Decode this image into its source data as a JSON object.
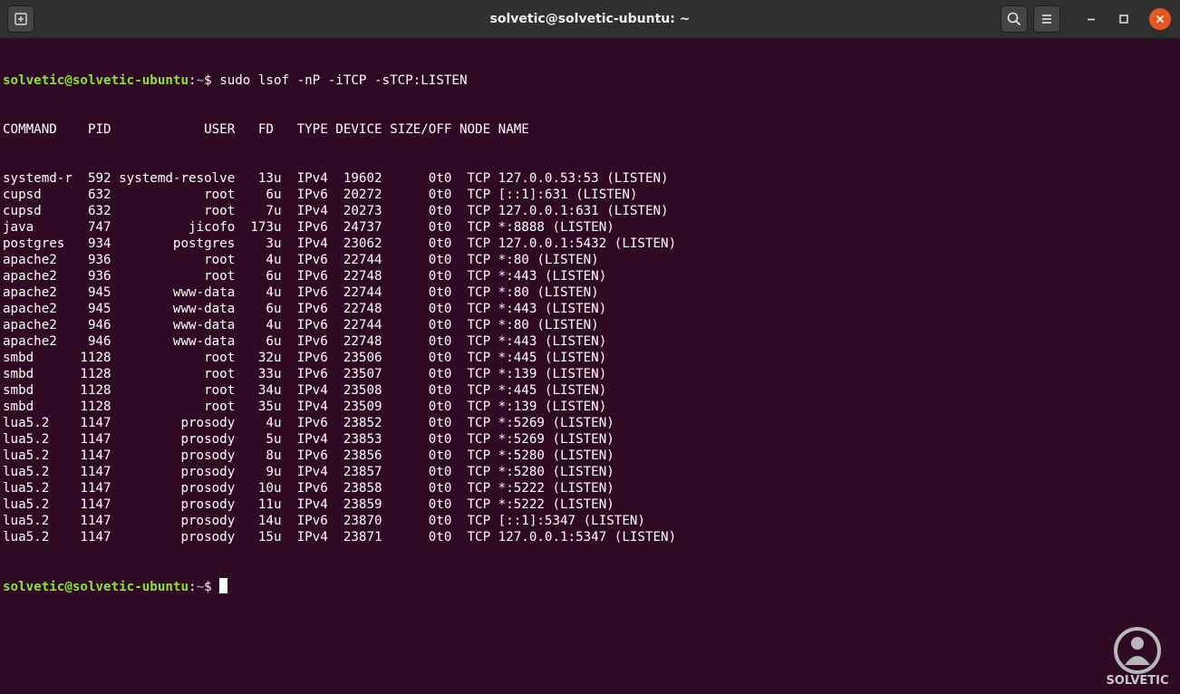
{
  "window": {
    "title": "solvetic@solvetic-ubuntu: ~",
    "buttons": {
      "new_tab_icon": "new-tab-icon",
      "search_icon": "search-icon",
      "menu_icon": "hamburger-menu-icon",
      "minimize_icon": "minimize-icon",
      "maximize_icon": "maximize-icon",
      "close_icon": "close-icon"
    },
    "accent_close": "#e95420"
  },
  "terminal": {
    "background": "#300a24",
    "prompt": {
      "user_host": "solvetic@solvetic-ubuntu",
      "sep": ":",
      "path": "~",
      "symbol": "$ "
    },
    "command": "sudo lsof -nP -iTCP -sTCP:LISTEN",
    "header": "COMMAND    PID            USER   FD   TYPE DEVICE SIZE/OFF NODE NAME",
    "rows": [
      "systemd-r  592 systemd-resolve   13u  IPv4  19602      0t0  TCP 127.0.0.53:53 (LISTEN)",
      "cupsd      632            root    6u  IPv6  20272      0t0  TCP [::1]:631 (LISTEN)",
      "cupsd      632            root    7u  IPv4  20273      0t0  TCP 127.0.0.1:631 (LISTEN)",
      "java       747          jicofo  173u  IPv6  24737      0t0  TCP *:8888 (LISTEN)",
      "postgres   934        postgres    3u  IPv4  23062      0t0  TCP 127.0.0.1:5432 (LISTEN)",
      "apache2    936            root    4u  IPv6  22744      0t0  TCP *:80 (LISTEN)",
      "apache2    936            root    6u  IPv6  22748      0t0  TCP *:443 (LISTEN)",
      "apache2    945        www-data    4u  IPv6  22744      0t0  TCP *:80 (LISTEN)",
      "apache2    945        www-data    6u  IPv6  22748      0t0  TCP *:443 (LISTEN)",
      "apache2    946        www-data    4u  IPv6  22744      0t0  TCP *:80 (LISTEN)",
      "apache2    946        www-data    6u  IPv6  22748      0t0  TCP *:443 (LISTEN)",
      "smbd      1128            root   32u  IPv6  23506      0t0  TCP *:445 (LISTEN)",
      "smbd      1128            root   33u  IPv6  23507      0t0  TCP *:139 (LISTEN)",
      "smbd      1128            root   34u  IPv4  23508      0t0  TCP *:445 (LISTEN)",
      "smbd      1128            root   35u  IPv4  23509      0t0  TCP *:139 (LISTEN)",
      "lua5.2    1147         prosody    4u  IPv6  23852      0t0  TCP *:5269 (LISTEN)",
      "lua5.2    1147         prosody    5u  IPv4  23853      0t0  TCP *:5269 (LISTEN)",
      "lua5.2    1147         prosody    8u  IPv6  23856      0t0  TCP *:5280 (LISTEN)",
      "lua5.2    1147         prosody    9u  IPv4  23857      0t0  TCP *:5280 (LISTEN)",
      "lua5.2    1147         prosody   10u  IPv6  23858      0t0  TCP *:5222 (LISTEN)",
      "lua5.2    1147         prosody   11u  IPv4  23859      0t0  TCP *:5222 (LISTEN)",
      "lua5.2    1147         prosody   14u  IPv6  23870      0t0  TCP [::1]:5347 (LISTEN)",
      "lua5.2    1147         prosody   15u  IPv4  23871      0t0  TCP 127.0.0.1:5347 (LISTEN)"
    ]
  },
  "watermark": {
    "text": "SOLVETIC",
    "icon": "solvetic-logo-icon"
  }
}
